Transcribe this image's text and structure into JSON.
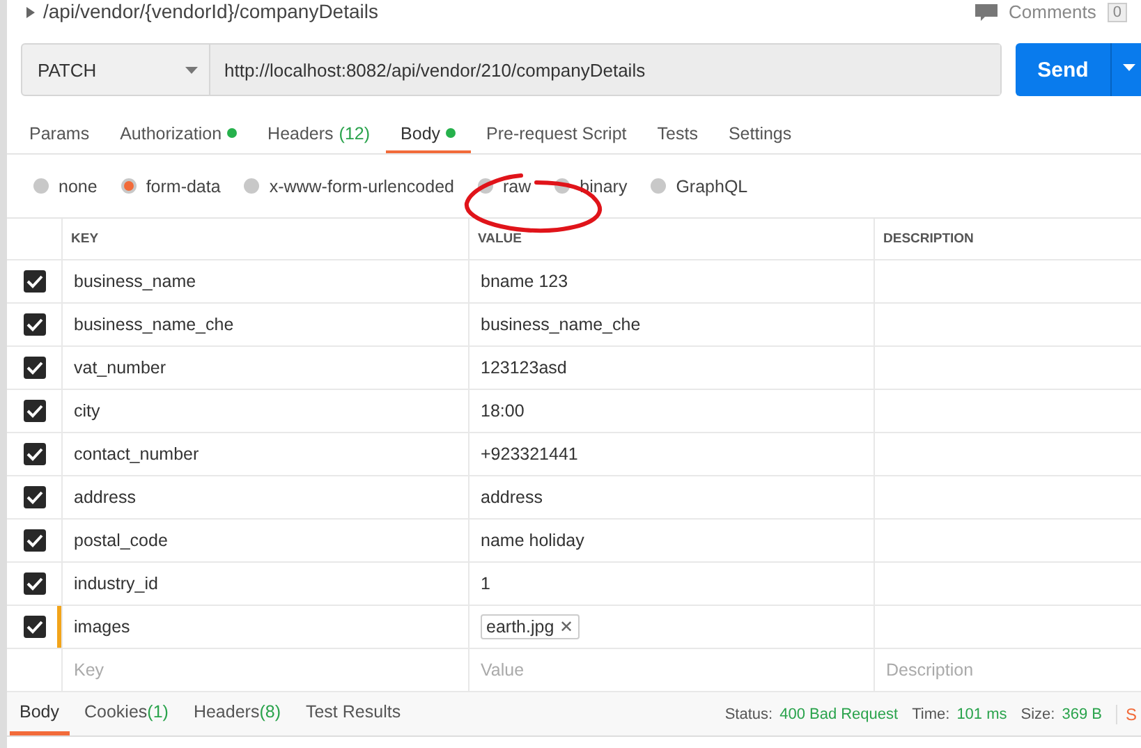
{
  "request_title": "/api/vendor/{vendorId}/companyDetails",
  "comments": {
    "label": "Comments",
    "count": "0"
  },
  "method": "PATCH",
  "url": "http://localhost:8082/api/vendor/210/companyDetails",
  "send": "Send",
  "tabs": [
    {
      "label": "Params",
      "selected": false,
      "dot": false
    },
    {
      "label": "Authorization",
      "selected": false,
      "dot": true
    },
    {
      "label": "Headers",
      "count": "(12)",
      "selected": false,
      "dot": false
    },
    {
      "label": "Body",
      "selected": true,
      "dot": true
    },
    {
      "label": "Pre-request Script",
      "selected": false,
      "dot": false
    },
    {
      "label": "Tests",
      "selected": false,
      "dot": false
    },
    {
      "label": "Settings",
      "selected": false,
      "dot": false
    }
  ],
  "body_modes": [
    {
      "label": "none",
      "selected": false
    },
    {
      "label": "form-data",
      "selected": true
    },
    {
      "label": "x-www-form-urlencoded",
      "selected": false
    },
    {
      "label": "raw",
      "selected": false
    },
    {
      "label": "binary",
      "selected": false
    },
    {
      "label": "GraphQL",
      "selected": false
    }
  ],
  "table": {
    "columns": [
      "KEY",
      "VALUE",
      "DESCRIPTION"
    ],
    "rows": [
      {
        "key": "business_name",
        "value": "bname 123",
        "checked": true,
        "kind": "text",
        "active": false
      },
      {
        "key": "business_name_che",
        "value": "business_name_che",
        "checked": true,
        "kind": "text",
        "active": false
      },
      {
        "key": "vat_number",
        "value": "123123asd",
        "checked": true,
        "kind": "text",
        "active": false
      },
      {
        "key": "city",
        "value": "18:00",
        "checked": true,
        "kind": "text",
        "active": false
      },
      {
        "key": "contact_number",
        "value": "+923321441",
        "checked": true,
        "kind": "text",
        "active": false
      },
      {
        "key": "address",
        "value": "address",
        "checked": true,
        "kind": "text",
        "active": false
      },
      {
        "key": "postal_code",
        "value": "name holiday",
        "checked": true,
        "kind": "text",
        "active": false
      },
      {
        "key": "industry_id",
        "value": "1",
        "checked": true,
        "kind": "text",
        "active": false
      },
      {
        "key": "images",
        "value": "earth.jpg",
        "remove": "✕",
        "checked": true,
        "kind": "file",
        "active": true
      }
    ],
    "new_row": {
      "key": "Key",
      "value": "Value",
      "description": "Description"
    }
  },
  "response": {
    "tabs": [
      {
        "label": "Body",
        "selected": true
      },
      {
        "label": "Cookies",
        "count": "(1)",
        "selected": false
      },
      {
        "label": "Headers",
        "count": "(8)",
        "selected": false
      },
      {
        "label": "Test Results",
        "selected": false
      }
    ],
    "stats": [
      {
        "label": "Status:",
        "value": "400 Bad Request"
      },
      {
        "label": "Time:",
        "value": "101 ms"
      },
      {
        "label": "Size:",
        "value": "369 B"
      }
    ],
    "save": "S"
  }
}
